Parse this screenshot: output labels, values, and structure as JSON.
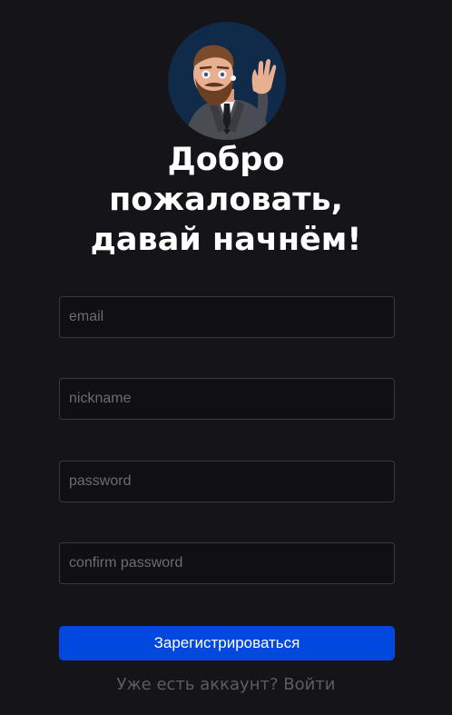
{
  "header": {
    "avatar_icon": "memoji-waving-man-icon",
    "title_lines": [
      "Добро",
      "пожаловать,",
      "давай начнём!"
    ]
  },
  "form": {
    "email_placeholder": "email",
    "nickname_placeholder": "nickname",
    "password_placeholder": "password",
    "confirm_placeholder": "confirm password",
    "submit_label": "Зарегистрироваться"
  },
  "footer": {
    "prompt": "Уже есть аккаунт?",
    "login_link": "Войти"
  },
  "colors": {
    "background": "#151419",
    "accent": "#0048e0",
    "avatar_bg": "#102a4a"
  }
}
